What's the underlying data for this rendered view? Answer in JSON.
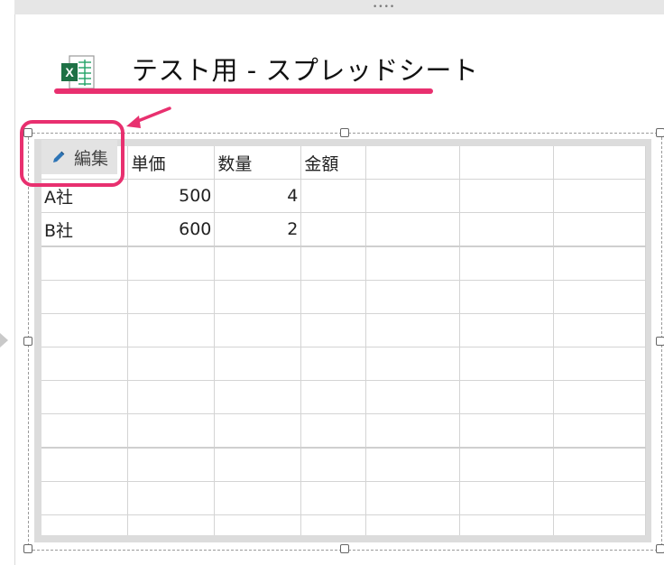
{
  "title": "テスト用 - スプレッドシート",
  "edit_button_label": "編集",
  "accent_color": "#e8306f",
  "excel_icon": {
    "name": "excel-icon",
    "letter": "X"
  },
  "sheet": {
    "rows": [
      [
        "",
        "単価",
        "数量",
        "金額",
        "",
        "",
        ""
      ],
      [
        "A社",
        "500",
        "4",
        "",
        "",
        "",
        ""
      ],
      [
        "B社",
        "600",
        "2",
        "",
        "",
        "",
        ""
      ],
      [
        "",
        "",
        "",
        "",
        "",
        "",
        ""
      ],
      [
        "",
        "",
        "",
        "",
        "",
        "",
        ""
      ],
      [
        "",
        "",
        "",
        "",
        "",
        "",
        ""
      ],
      [
        "",
        "",
        "",
        "",
        "",
        "",
        ""
      ],
      [
        "",
        "",
        "",
        "",
        "",
        "",
        ""
      ],
      [
        "",
        "",
        "",
        "",
        "",
        "",
        ""
      ],
      [
        "",
        "",
        "",
        "",
        "",
        "",
        ""
      ],
      [
        "",
        "",
        "",
        "",
        "",
        "",
        ""
      ],
      [
        "",
        "",
        "",
        "",
        "",
        "",
        ""
      ]
    ],
    "numeric_columns": [
      1,
      2
    ]
  }
}
